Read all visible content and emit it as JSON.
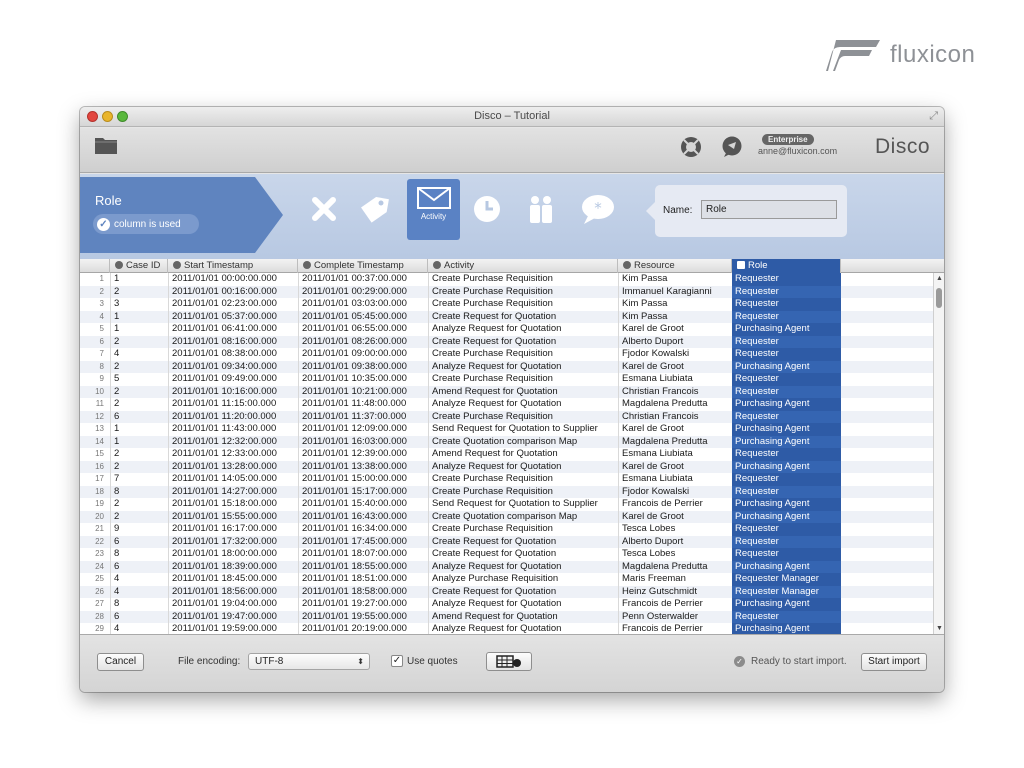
{
  "brand": {
    "name": "fluxicon"
  },
  "window": {
    "title": "Disco – Tutorial"
  },
  "toolbar": {
    "badge": "Enterprise",
    "user": "anne@fluxicon.com",
    "logo": "Disco"
  },
  "config": {
    "column_title": "Role",
    "used_label": "column is used",
    "selected_type_label": "Activity",
    "name_label": "Name:",
    "name_value": "Role"
  },
  "table": {
    "headers": [
      "Case ID",
      "Start Timestamp",
      "Complete Timestamp",
      "Activity",
      "Resource",
      "Role"
    ],
    "rows": [
      [
        "1",
        "2011/01/01 00:00:00.000",
        "2011/01/01 00:37:00.000",
        "Create Purchase Requisition",
        "Kim Passa",
        "Requester"
      ],
      [
        "2",
        "2011/01/01 00:16:00.000",
        "2011/01/01 00:29:00.000",
        "Create Purchase Requisition",
        "Immanuel Karagianni",
        "Requester"
      ],
      [
        "3",
        "2011/01/01 02:23:00.000",
        "2011/01/01 03:03:00.000",
        "Create Purchase Requisition",
        "Kim Passa",
        "Requester"
      ],
      [
        "1",
        "2011/01/01 05:37:00.000",
        "2011/01/01 05:45:00.000",
        "Create Request for Quotation",
        "Kim Passa",
        "Requester"
      ],
      [
        "1",
        "2011/01/01 06:41:00.000",
        "2011/01/01 06:55:00.000",
        "Analyze Request for Quotation",
        "Karel de Groot",
        "Purchasing Agent"
      ],
      [
        "2",
        "2011/01/01 08:16:00.000",
        "2011/01/01 08:26:00.000",
        "Create Request for Quotation",
        "Alberto Duport",
        "Requester"
      ],
      [
        "4",
        "2011/01/01 08:38:00.000",
        "2011/01/01 09:00:00.000",
        "Create Purchase Requisition",
        "Fjodor Kowalski",
        "Requester"
      ],
      [
        "2",
        "2011/01/01 09:34:00.000",
        "2011/01/01 09:38:00.000",
        "Analyze Request for Quotation",
        "Karel de Groot",
        "Purchasing Agent"
      ],
      [
        "5",
        "2011/01/01 09:49:00.000",
        "2011/01/01 10:35:00.000",
        "Create Purchase Requisition",
        "Esmana Liubiata",
        "Requester"
      ],
      [
        "2",
        "2011/01/01 10:16:00.000",
        "2011/01/01 10:21:00.000",
        "Amend Request for Quotation",
        "Christian Francois",
        "Requester"
      ],
      [
        "2",
        "2011/01/01 11:15:00.000",
        "2011/01/01 11:48:00.000",
        "Analyze Request for Quotation",
        "Magdalena Predutta",
        "Purchasing Agent"
      ],
      [
        "6",
        "2011/01/01 11:20:00.000",
        "2011/01/01 11:37:00.000",
        "Create Purchase Requisition",
        "Christian Francois",
        "Requester"
      ],
      [
        "1",
        "2011/01/01 11:43:00.000",
        "2011/01/01 12:09:00.000",
        "Send Request for Quotation to Supplier",
        "Karel de Groot",
        "Purchasing Agent"
      ],
      [
        "1",
        "2011/01/01 12:32:00.000",
        "2011/01/01 16:03:00.000",
        "Create Quotation comparison Map",
        "Magdalena Predutta",
        "Purchasing Agent"
      ],
      [
        "2",
        "2011/01/01 12:33:00.000",
        "2011/01/01 12:39:00.000",
        "Amend Request for Quotation",
        "Esmana Liubiata",
        "Requester"
      ],
      [
        "2",
        "2011/01/01 13:28:00.000",
        "2011/01/01 13:38:00.000",
        "Analyze Request for Quotation",
        "Karel de Groot",
        "Purchasing Agent"
      ],
      [
        "7",
        "2011/01/01 14:05:00.000",
        "2011/01/01 15:00:00.000",
        "Create Purchase Requisition",
        "Esmana Liubiata",
        "Requester"
      ],
      [
        "8",
        "2011/01/01 14:27:00.000",
        "2011/01/01 15:17:00.000",
        "Create Purchase Requisition",
        "Fjodor Kowalski",
        "Requester"
      ],
      [
        "2",
        "2011/01/01 15:18:00.000",
        "2011/01/01 15:40:00.000",
        "Send Request for Quotation to Supplier",
        "Francois de Perrier",
        "Purchasing Agent"
      ],
      [
        "2",
        "2011/01/01 15:55:00.000",
        "2011/01/01 16:43:00.000",
        "Create Quotation comparison Map",
        "Karel de Groot",
        "Purchasing Agent"
      ],
      [
        "9",
        "2011/01/01 16:17:00.000",
        "2011/01/01 16:34:00.000",
        "Create Purchase Requisition",
        "Tesca Lobes",
        "Requester"
      ],
      [
        "6",
        "2011/01/01 17:32:00.000",
        "2011/01/01 17:45:00.000",
        "Create Request for Quotation",
        "Alberto Duport",
        "Requester"
      ],
      [
        "8",
        "2011/01/01 18:00:00.000",
        "2011/01/01 18:07:00.000",
        "Create Request for Quotation",
        "Tesca Lobes",
        "Requester"
      ],
      [
        "6",
        "2011/01/01 18:39:00.000",
        "2011/01/01 18:55:00.000",
        "Analyze Request for Quotation",
        "Magdalena Predutta",
        "Purchasing Agent"
      ],
      [
        "4",
        "2011/01/01 18:45:00.000",
        "2011/01/01 18:51:00.000",
        "Analyze Purchase Requisition",
        "Maris Freeman",
        "Requester Manager"
      ],
      [
        "4",
        "2011/01/01 18:56:00.000",
        "2011/01/01 18:58:00.000",
        "Create Request for Quotation",
        "Heinz Gutschmidt",
        "Requester Manager"
      ],
      [
        "8",
        "2011/01/01 19:04:00.000",
        "2011/01/01 19:27:00.000",
        "Analyze Request for Quotation",
        "Francois de Perrier",
        "Purchasing Agent"
      ],
      [
        "6",
        "2011/01/01 19:47:00.000",
        "2011/01/01 19:55:00.000",
        "Amend Request for Quotation",
        "Penn Osterwalder",
        "Requester"
      ],
      [
        "4",
        "2011/01/01 19:59:00.000",
        "2011/01/01 20:19:00.000",
        "Analyze Request for Quotation",
        "Francois de Perrier",
        "Purchasing Agent"
      ]
    ]
  },
  "footer": {
    "cancel": "Cancel",
    "encoding_label": "File encoding:",
    "encoding_value": "UTF-8",
    "quotes_label": "Use quotes",
    "status": "Ready to start import.",
    "start": "Start import"
  },
  "colors": {
    "accent": "#2e5ba6",
    "panel": "#c9d6ea",
    "role_arrow": "#5f84bf"
  }
}
